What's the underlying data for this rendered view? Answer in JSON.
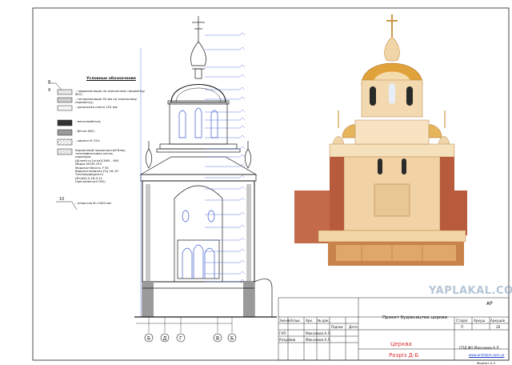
{
  "legend": {
    "title": "Условные обозначения",
    "items": [
      {
        "tag": "8",
        "text": "- гидроизоляция по зональному периметру ФЗС;"
      },
      {
        "tag": "9",
        "text": "- теплоизоляция 50 мм по зональному периметру;"
      },
      {
        "tag": "",
        "text": "- цокольная плита 120 мм;"
      },
      {
        "tag": "",
        "text": "- металлобетон;"
      },
      {
        "tag": "",
        "text": "- бетон ФЗС;"
      },
      {
        "tag": "",
        "text": "- кирпич М 150;"
      },
      {
        "tag": "",
        "text": "Керамічний порожнистий блок, теплоефективна цегла,\nпарапори.\nЩільність [кг/м3] 865 - 900\nМарка М100-150\nМорозостійкість F 50\nВодопоглинання [%] 16-19\nТеплопровідність\n[Вт/мК] 0,16-0,21\n(при вологості 8%)"
      },
      {
        "tag": "10",
        "text": "- отмостка В=1000 мм"
      }
    ]
  },
  "axes": [
    "Б",
    "Д",
    "Г",
    "В",
    "Б"
  ],
  "title_block": {
    "code": "АР",
    "project": "Проект будівництва церкви",
    "sheet_title": "Церква",
    "section_title": "Розріз Д-Б",
    "headers": [
      "Змінів",
      "Кільк.",
      "Арк.",
      "№ док.",
      "Підпис",
      "Дата"
    ],
    "rows": [
      {
        "role": "ГАП",
        "name": "Максимов А.Л."
      },
      {
        "role": "Розробив",
        "name": "Максимов А.Л."
      }
    ],
    "stage_headers": [
      "Стадія",
      "Аркуш",
      "Аркушів"
    ],
    "stage_values": [
      "П",
      "",
      "26"
    ],
    "author": "СПД ФО Максимов А.Л.",
    "site": "www.archdom.com.ua",
    "format": "Формат А-3"
  },
  "watermark": "YAPLAKAL.COM",
  "colors": {
    "line": "#1a1a1a",
    "blue": "#3a5ad0",
    "brick": "#b85a3c",
    "gold": "#e0a23a",
    "cream": "#f0d5a8"
  }
}
